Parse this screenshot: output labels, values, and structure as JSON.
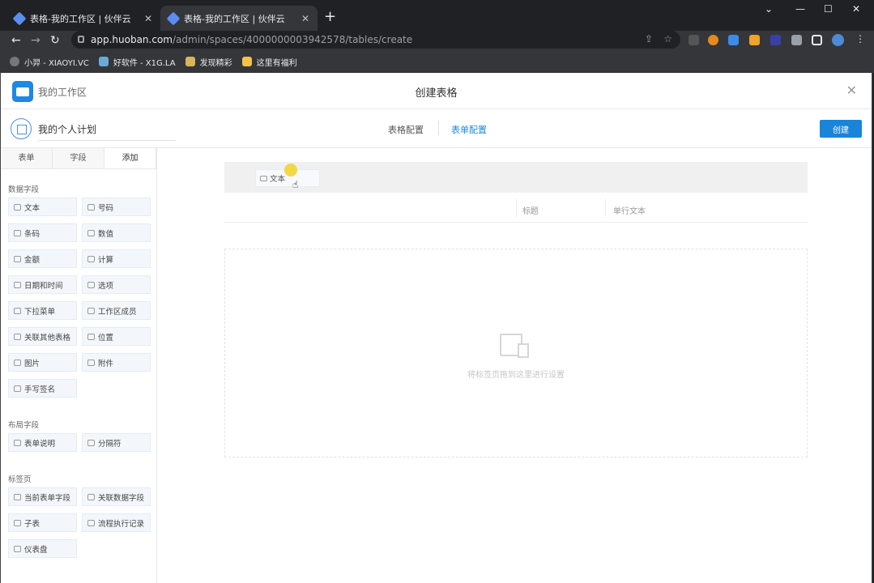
{
  "browser": {
    "tabs": [
      {
        "title": "表格-我的工作区 | 伙伴云",
        "active": false
      },
      {
        "title": "表格-我的工作区 | 伙伴云",
        "active": true
      }
    ],
    "url_host": "app.huoban.com",
    "url_path": "/admin/spaces/4000000003942578/tables/create",
    "bookmarks": [
      "小羿 - XIAOYI.VC",
      "好软件 - X1G.LA",
      "发现精彩",
      "这里有福利"
    ]
  },
  "header": {
    "workspace_name": "我的工作区",
    "dialog_title": "创建表格",
    "close_icon": "✕"
  },
  "subheader": {
    "table_name": "我的个人计划",
    "tabs": [
      "表格配置",
      "表单配置"
    ],
    "active_tab": "表单配置",
    "create_button": "创建"
  },
  "sidebar": {
    "tabs": [
      "表单",
      "字段",
      "添加"
    ],
    "active_tab": "添加",
    "sections": {
      "data_fields": {
        "title": "数据字段",
        "items": [
          "文本",
          "号码",
          "条码",
          "数值",
          "金额",
          "计算",
          "日期和时间",
          "选项",
          "下拉菜单",
          "工作区成员",
          "关联其他表格",
          "位置",
          "图片",
          "附件",
          "手写签名"
        ]
      },
      "layout_fields": {
        "title": "布局字段",
        "items": [
          "表单说明",
          "分隔符"
        ]
      },
      "tab_pages": {
        "title": "标签页",
        "items": [
          "当前表单字段",
          "关联数据字段",
          "子表",
          "流程执行记录",
          "仪表盘"
        ]
      }
    }
  },
  "canvas": {
    "dragging_chip": "文本",
    "field_row": {
      "label_col": "标题",
      "type_col": "单行文本"
    },
    "drop_hint": "将标签页拖到这里进行设置"
  },
  "colors": {
    "accent": "#1a84d8",
    "item_bg": "#f3f7fc",
    "cursor_highlight": "#f0d228"
  }
}
